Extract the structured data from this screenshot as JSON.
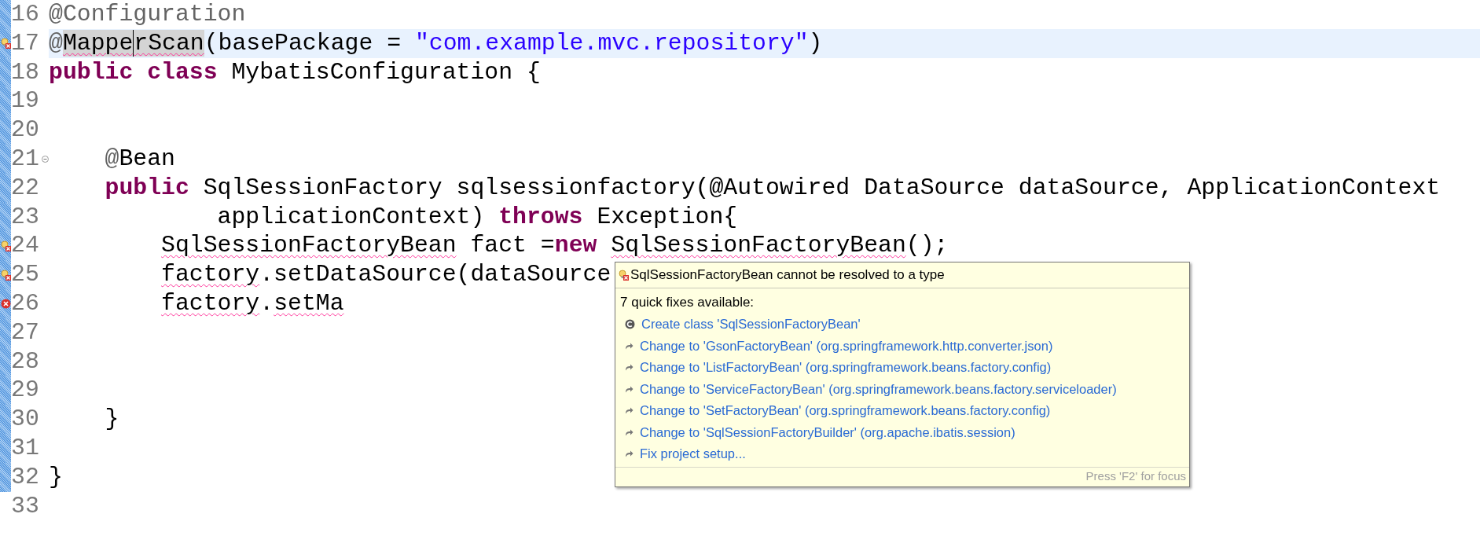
{
  "editor": {
    "lines": [
      {
        "number": "16",
        "changed": true,
        "current": false,
        "tokens": [
          {
            "text": "@Configuration",
            "kind": "annotation"
          }
        ]
      },
      {
        "number": "17",
        "markers": [
          {
            "kind": "bulb-error"
          }
        ],
        "changed": true,
        "current": true,
        "tokens": [
          {
            "text": "@",
            "kind": "annotation"
          },
          {
            "text": "Mappe",
            "kind": "plain",
            "error": true,
            "highlight": true,
            "caret": true
          },
          {
            "text": "rScan",
            "kind": "plain",
            "error": true,
            "highlight": true
          },
          {
            "text": "(basePackage = ",
            "kind": "plain"
          },
          {
            "text": "\"com.example.mvc.repository\"",
            "kind": "string"
          },
          {
            "text": ")",
            "kind": "plain"
          }
        ]
      },
      {
        "number": "18",
        "changed": true,
        "current": false,
        "tokens": [
          {
            "text": "public",
            "kind": "keyword"
          },
          {
            "text": " class",
            "kind": "keyword"
          },
          {
            "text": " MybatisConfiguration {",
            "kind": "plain"
          }
        ]
      },
      {
        "number": "19",
        "changed": true,
        "current": false
      },
      {
        "number": "20",
        "changed": true,
        "current": false
      },
      {
        "number": "21",
        "markers": [
          {
            "kind": "fold"
          }
        ],
        "changed": true,
        "current": false,
        "tokens": [
          {
            "text": "    @",
            "kind": "annotation"
          },
          {
            "text": "Bean",
            "kind": "plain"
          }
        ]
      },
      {
        "number": "22",
        "changed": true,
        "current": false,
        "tokens": [
          {
            "text": "    public",
            "kind": "keyword"
          },
          {
            "text": " SqlSessionFactory sqlsessionfactory(@Autowired DataSource dataSource, ApplicationContext",
            "kind": "plain"
          }
        ]
      },
      {
        "number": "23",
        "changed": true,
        "current": false,
        "tokens": [
          {
            "text": "            applicationContext) ",
            "kind": "plain"
          },
          {
            "text": "throws",
            "kind": "keyword"
          },
          {
            "text": " Exception{",
            "kind": "plain"
          }
        ]
      },
      {
        "number": "24",
        "markers": [
          {
            "kind": "bulb-error"
          }
        ],
        "changed": true,
        "current": false,
        "tokens": [
          {
            "text": "        SqlSessionFactoryBean",
            "kind": "plain",
            "error": true
          },
          {
            "text": " fact =",
            "kind": "plain"
          },
          {
            "text": "new ",
            "kind": "keyword"
          },
          {
            "text": "SqlSessionFactoryBean",
            "kind": "plain",
            "error": true
          },
          {
            "text": "();",
            "kind": "plain"
          }
        ]
      },
      {
        "number": "25",
        "markers": [
          {
            "kind": "bulb-error"
          }
        ],
        "changed": true,
        "current": false,
        "tokens": [
          {
            "text": "        factory",
            "kind": "plain",
            "error": true
          },
          {
            "text": ".setDataSource(dataSource",
            "kind": "plain"
          }
        ]
      },
      {
        "number": "26",
        "markers": [
          {
            "kind": "error"
          }
        ],
        "changed": true,
        "current": false,
        "tokens": [
          {
            "text": "        factory",
            "kind": "plain",
            "error": true
          },
          {
            "text": ".",
            "kind": "plain"
          },
          {
            "text": "setMa",
            "kind": "plain",
            "error": true
          }
        ]
      },
      {
        "number": "27",
        "changed": true,
        "current": false
      },
      {
        "number": "28",
        "changed": true,
        "current": false
      },
      {
        "number": "29",
        "changed": true,
        "current": false
      },
      {
        "number": "30",
        "changed": true,
        "current": false,
        "tokens": [
          {
            "text": "    }",
            "kind": "plain"
          }
        ]
      },
      {
        "number": "31",
        "changed": true,
        "current": false
      },
      {
        "number": "32",
        "changed": true,
        "current": false,
        "tokens": [
          {
            "text": "}",
            "kind": "plain"
          }
        ]
      },
      {
        "number": "33",
        "changed": false,
        "current": false
      }
    ]
  },
  "quick_fix_popup": {
    "title": "SqlSessionFactoryBean cannot be resolved to a type",
    "count_label": "7 quick fixes available:",
    "fixes": [
      {
        "kind": "create",
        "label": "Create class 'SqlSessionFactoryBean'"
      },
      {
        "kind": "change",
        "label": "Change to 'GsonFactoryBean' (org.springframework.http.converter.json)"
      },
      {
        "kind": "change",
        "label": "Change to 'ListFactoryBean' (org.springframework.beans.factory.config)"
      },
      {
        "kind": "change",
        "label": "Change to 'ServiceFactoryBean' (org.springframework.beans.factory.serviceloader)"
      },
      {
        "kind": "change",
        "label": "Change to 'SetFactoryBean' (org.springframework.beans.factory.config)"
      },
      {
        "kind": "change",
        "label": "Change to 'SqlSessionFactoryBuilder' (org.apache.ibatis.session)"
      },
      {
        "kind": "change",
        "label": "Fix project setup..."
      }
    ],
    "footer": "Press 'F2' for focus"
  }
}
